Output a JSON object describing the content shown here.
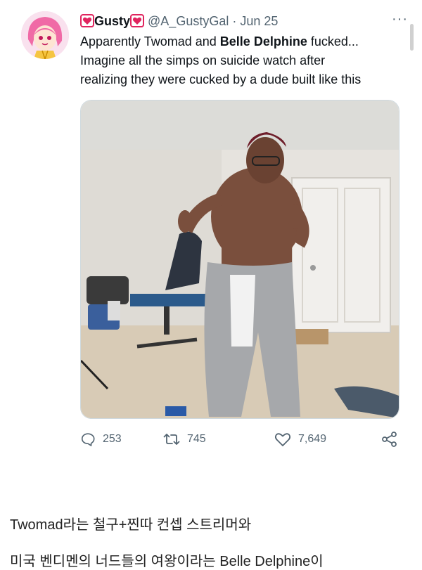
{
  "tweet": {
    "display_name": "Gusty",
    "handle": "@A_GustyGal",
    "date": "· Jun 25",
    "more": "···",
    "text_line1_pre": "Apparently Twomad and ",
    "text_line1_bold": "Belle Delphine",
    "text_line1_post": " fucked...",
    "text_line2": "Imagine all the simps on suicide watch after",
    "text_line3": "realizing they were cucked by a dude built like this",
    "stats": {
      "replies": "253",
      "retweets": "745",
      "likes": "7,649"
    }
  },
  "article": {
    "line1": "Twomad라는 철구+찐따 컨셉 스트리머와",
    "line2": "미국 벤디멘의 너드들의 여왕이라는 Belle Delphine이"
  },
  "colors": {
    "muted": "#536471",
    "heart_red": "#e0245e"
  }
}
